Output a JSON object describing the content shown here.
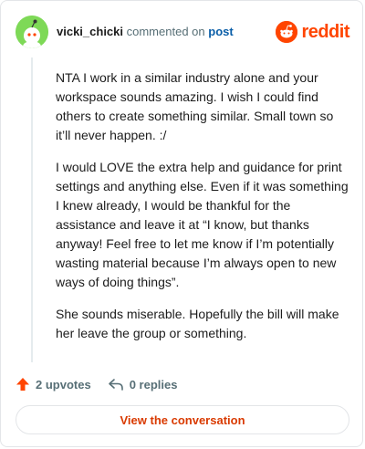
{
  "header": {
    "username": "vicki_chicki",
    "action_text": "commented on",
    "post_link": "post",
    "logo_text": "reddit"
  },
  "comment": {
    "paragraphs": [
      "NTA I work in a similar industry alone and your workspace sounds amazing. I wish I could find others to create something similar. Small town so it’ll never happen. :/",
      "I would LOVE the extra help and guidance for print settings and anything else. Even if it was something I knew already, I would be thankful for the assistance and leave it at “I know, but thanks anyway! Feel free to let me know if I’m potentially wasting material because I’m always open to new ways of doing things”.",
      "She sounds miserable. Hopefully the bill will make her leave the group or something."
    ]
  },
  "actions": {
    "upvotes_label": "2 upvotes",
    "replies_label": "0 replies"
  },
  "footer": {
    "view_button": "View the conversation"
  },
  "colors": {
    "brand": "#ff4500",
    "link": "#0a5ea8",
    "button_text": "#d93a00",
    "avatar_bg": "#7ed957"
  },
  "icons": {
    "avatar": "snoo-avatar-icon",
    "logo": "reddit-logo-icon",
    "upvote": "upvote-arrow-icon",
    "reply": "reply-arrow-icon"
  }
}
